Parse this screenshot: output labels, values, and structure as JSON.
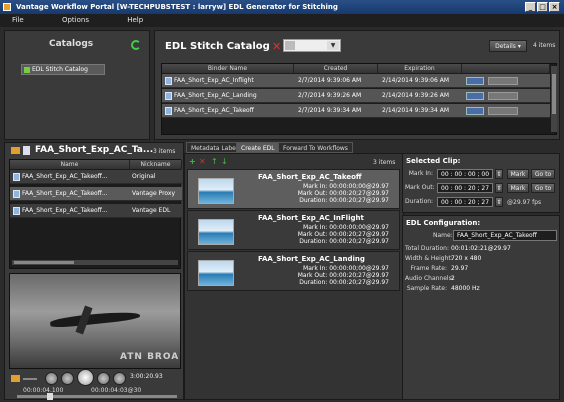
{
  "window": {
    "title": "Vantage Workflow Portal [W-TECHPUBSTEST : larryw] EDL Generator for Stitching"
  },
  "menu": [
    "File",
    "Options",
    "Help"
  ],
  "catalogs": {
    "title": "Catalogs",
    "items": [
      "EDL Stitch Catalog"
    ]
  },
  "stitch_catalog": {
    "title": "EDL Stitch Catalog",
    "details_label": "Details",
    "item_count": "4 items",
    "columns": [
      "Binder Name",
      "Created",
      "Expiration"
    ],
    "rows": [
      {
        "name": "FAA_Short_Exp_AC_Inflight",
        "created": "2/7/2014 9:39:06 AM",
        "expiration": "2/14/2014 9:39:06 AM"
      },
      {
        "name": "FAA_Short_Exp_AC_Landing",
        "created": "2/7/2014 9:39:26 AM",
        "expiration": "2/14/2014 9:39:26 AM"
      },
      {
        "name": "FAA_Short_Exp_AC_Takeoff",
        "created": "2/7/2014 9:39:34 AM",
        "expiration": "2/14/2014 9:39:34 AM"
      }
    ]
  },
  "binder": {
    "title": "FAA_Short_Exp_AC_Ta...",
    "count": "3 items",
    "columns": [
      "Name",
      "Nickname"
    ],
    "rows": [
      {
        "name": "FAA_Short_Exp_AC_Takeoff...",
        "nickname": "Original"
      },
      {
        "name": "FAA_Short_Exp_AC_Takeoff...",
        "nickname": "Vantage Proxy"
      },
      {
        "name": "FAA_Short_Exp_AC_Takeoff...",
        "nickname": "Vantage EDL"
      }
    ]
  },
  "player": {
    "timecode": "3:00:20.93",
    "position": "00:00:04.100",
    "duration": "00:00:04:03@30",
    "watermark": "ATN BROA"
  },
  "tabs": [
    "Metadata Labels",
    "Create EDL",
    "Forward To Workflows"
  ],
  "edl": {
    "count": "3 items",
    "clips": [
      {
        "title": "FAA_Short_Exp_AC_Takeoff",
        "mark_in": "Mark In:  00:00:00;00@29.97",
        "mark_out": "Mark Out:  00:00:20;27@29.97",
        "duration": "Duration:  00:00:20;27@29.97"
      },
      {
        "title": "FAA_Short_Exp_AC_InFlight",
        "mark_in": "Mark In:  00:00:00;00@29.97",
        "mark_out": "Mark Out:  00:00:20;27@29.97",
        "duration": "Duration:  00:00:20;27@29.97"
      },
      {
        "title": "FAA_Short_Exp_AC_Landing",
        "mark_in": "Mark In:  00:00:00;00@29.97",
        "mark_out": "Mark Out:  00:00:20;27@29.97",
        "duration": "Duration:  00:00:20;27@29.97"
      }
    ]
  },
  "selected_clip": {
    "title": "Selected Clip:",
    "mark_in_label": "Mark In:",
    "mark_in": "00 : 00 : 00 ; 00",
    "mark_out_label": "Mark Out:",
    "mark_out": "00 : 00 : 20 ; 27",
    "duration_label": "Duration:",
    "duration": "00 : 00 : 20 ; 27",
    "fps": "@29.97 fps",
    "mark_btn": "Mark",
    "goto_btn": "Go to"
  },
  "edl_config": {
    "title": "EDL Configuration:",
    "name_label": "Name:",
    "name": "FAA_Short_Exp_AC_Takeoff",
    "fields": [
      {
        "label": "Total Duration:",
        "value": "00:01:02:21@29.97"
      },
      {
        "label": "Width & Height:",
        "value": "720 x 480"
      },
      {
        "label": "Frame Rate:",
        "value": "29.97"
      },
      {
        "label": "Audio Channels:",
        "value": "2"
      },
      {
        "label": "Sample Rate:",
        "value": "48000 Hz"
      }
    ]
  }
}
